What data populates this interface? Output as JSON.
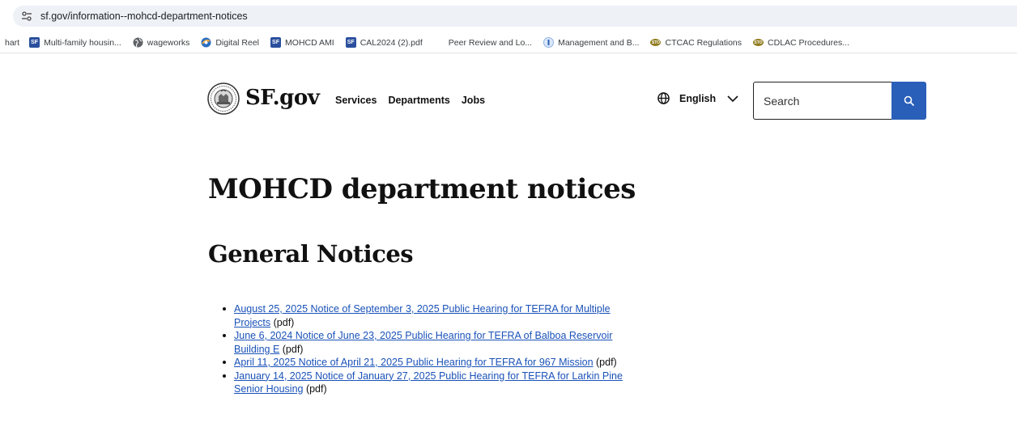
{
  "browser": {
    "url": "sf.gov/information--mohcd-department-notices",
    "bookmarks": [
      {
        "label": "hart",
        "icon": "none"
      },
      {
        "label": "Multi-family housin...",
        "icon": "sf-icon"
      },
      {
        "label": "wageworks",
        "icon": "globe-icon"
      },
      {
        "label": "Digital Reel",
        "icon": "digital-reel-icon"
      },
      {
        "label": "MOHCD AMI",
        "icon": "sf-icon"
      },
      {
        "label": "CAL2024 (2).pdf",
        "icon": "sf-icon"
      },
      {
        "label": "Peer Review and Lo...",
        "icon": "microsoft-icon"
      },
      {
        "label": "Management and B...",
        "icon": "circle-icon"
      },
      {
        "label": "CTCAC Regulations",
        "icon": "sto-icon"
      },
      {
        "label": "CDLAC Procedures...",
        "icon": "sto-icon"
      }
    ]
  },
  "header": {
    "brand": "SF.gov",
    "nav": [
      {
        "label": "Services"
      },
      {
        "label": "Departments"
      },
      {
        "label": "Jobs"
      }
    ],
    "language": "English",
    "search_placeholder": "Search"
  },
  "main": {
    "title": "MOHCD department notices",
    "section_title": "General Notices",
    "notices": [
      {
        "link": "August 25, 2025 Notice of September 3, 2025 Public Hearing for TEFRA for Multiple Projects",
        "suffix": " (pdf)"
      },
      {
        "link": "June 6, 2024 Notice of June 23, 2025 Public Hearing for TEFRA of Balboa Reservoir Building E",
        "suffix": " (pdf)"
      },
      {
        "link": "April 11, 2025 Notice of April 21, 2025 Public Hearing for TEFRA for 967 Mission",
        "suffix": " (pdf)"
      },
      {
        "link": "January 14, 2025 Notice of January 27, 2025 Public Hearing for TEFRA for Larkin Pine Senior Housing",
        "suffix": " (pdf)"
      }
    ]
  },
  "colors": {
    "link": "#1a52b8",
    "search_button": "#2a5fb9",
    "omnibox": "#eef1f6"
  }
}
